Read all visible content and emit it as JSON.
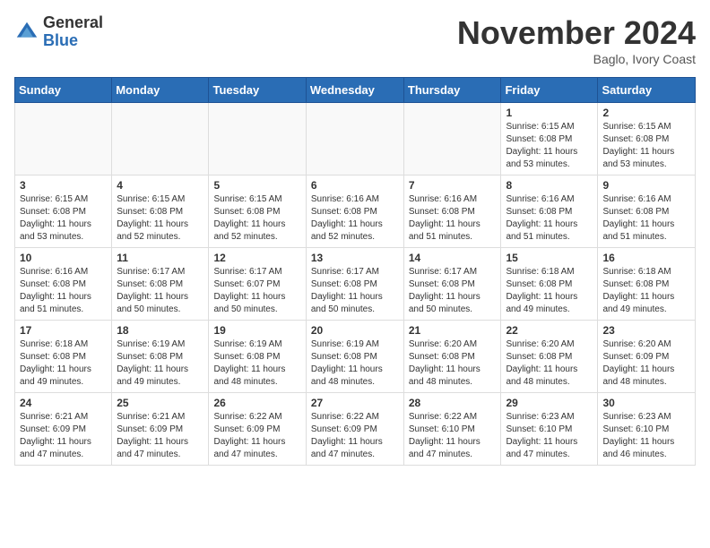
{
  "header": {
    "logo_general": "General",
    "logo_blue": "Blue",
    "month_title": "November 2024",
    "location": "Baglo, Ivory Coast"
  },
  "weekdays": [
    "Sunday",
    "Monday",
    "Tuesday",
    "Wednesday",
    "Thursday",
    "Friday",
    "Saturday"
  ],
  "weeks": [
    [
      {
        "day": "",
        "info": ""
      },
      {
        "day": "",
        "info": ""
      },
      {
        "day": "",
        "info": ""
      },
      {
        "day": "",
        "info": ""
      },
      {
        "day": "",
        "info": ""
      },
      {
        "day": "1",
        "info": "Sunrise: 6:15 AM\nSunset: 6:08 PM\nDaylight: 11 hours\nand 53 minutes."
      },
      {
        "day": "2",
        "info": "Sunrise: 6:15 AM\nSunset: 6:08 PM\nDaylight: 11 hours\nand 53 minutes."
      }
    ],
    [
      {
        "day": "3",
        "info": "Sunrise: 6:15 AM\nSunset: 6:08 PM\nDaylight: 11 hours\nand 53 minutes."
      },
      {
        "day": "4",
        "info": "Sunrise: 6:15 AM\nSunset: 6:08 PM\nDaylight: 11 hours\nand 52 minutes."
      },
      {
        "day": "5",
        "info": "Sunrise: 6:15 AM\nSunset: 6:08 PM\nDaylight: 11 hours\nand 52 minutes."
      },
      {
        "day": "6",
        "info": "Sunrise: 6:16 AM\nSunset: 6:08 PM\nDaylight: 11 hours\nand 52 minutes."
      },
      {
        "day": "7",
        "info": "Sunrise: 6:16 AM\nSunset: 6:08 PM\nDaylight: 11 hours\nand 51 minutes."
      },
      {
        "day": "8",
        "info": "Sunrise: 6:16 AM\nSunset: 6:08 PM\nDaylight: 11 hours\nand 51 minutes."
      },
      {
        "day": "9",
        "info": "Sunrise: 6:16 AM\nSunset: 6:08 PM\nDaylight: 11 hours\nand 51 minutes."
      }
    ],
    [
      {
        "day": "10",
        "info": "Sunrise: 6:16 AM\nSunset: 6:08 PM\nDaylight: 11 hours\nand 51 minutes."
      },
      {
        "day": "11",
        "info": "Sunrise: 6:17 AM\nSunset: 6:08 PM\nDaylight: 11 hours\nand 50 minutes."
      },
      {
        "day": "12",
        "info": "Sunrise: 6:17 AM\nSunset: 6:07 PM\nDaylight: 11 hours\nand 50 minutes."
      },
      {
        "day": "13",
        "info": "Sunrise: 6:17 AM\nSunset: 6:08 PM\nDaylight: 11 hours\nand 50 minutes."
      },
      {
        "day": "14",
        "info": "Sunrise: 6:17 AM\nSunset: 6:08 PM\nDaylight: 11 hours\nand 50 minutes."
      },
      {
        "day": "15",
        "info": "Sunrise: 6:18 AM\nSunset: 6:08 PM\nDaylight: 11 hours\nand 49 minutes."
      },
      {
        "day": "16",
        "info": "Sunrise: 6:18 AM\nSunset: 6:08 PM\nDaylight: 11 hours\nand 49 minutes."
      }
    ],
    [
      {
        "day": "17",
        "info": "Sunrise: 6:18 AM\nSunset: 6:08 PM\nDaylight: 11 hours\nand 49 minutes."
      },
      {
        "day": "18",
        "info": "Sunrise: 6:19 AM\nSunset: 6:08 PM\nDaylight: 11 hours\nand 49 minutes."
      },
      {
        "day": "19",
        "info": "Sunrise: 6:19 AM\nSunset: 6:08 PM\nDaylight: 11 hours\nand 48 minutes."
      },
      {
        "day": "20",
        "info": "Sunrise: 6:19 AM\nSunset: 6:08 PM\nDaylight: 11 hours\nand 48 minutes."
      },
      {
        "day": "21",
        "info": "Sunrise: 6:20 AM\nSunset: 6:08 PM\nDaylight: 11 hours\nand 48 minutes."
      },
      {
        "day": "22",
        "info": "Sunrise: 6:20 AM\nSunset: 6:08 PM\nDaylight: 11 hours\nand 48 minutes."
      },
      {
        "day": "23",
        "info": "Sunrise: 6:20 AM\nSunset: 6:09 PM\nDaylight: 11 hours\nand 48 minutes."
      }
    ],
    [
      {
        "day": "24",
        "info": "Sunrise: 6:21 AM\nSunset: 6:09 PM\nDaylight: 11 hours\nand 47 minutes."
      },
      {
        "day": "25",
        "info": "Sunrise: 6:21 AM\nSunset: 6:09 PM\nDaylight: 11 hours\nand 47 minutes."
      },
      {
        "day": "26",
        "info": "Sunrise: 6:22 AM\nSunset: 6:09 PM\nDaylight: 11 hours\nand 47 minutes."
      },
      {
        "day": "27",
        "info": "Sunrise: 6:22 AM\nSunset: 6:09 PM\nDaylight: 11 hours\nand 47 minutes."
      },
      {
        "day": "28",
        "info": "Sunrise: 6:22 AM\nSunset: 6:10 PM\nDaylight: 11 hours\nand 47 minutes."
      },
      {
        "day": "29",
        "info": "Sunrise: 6:23 AM\nSunset: 6:10 PM\nDaylight: 11 hours\nand 47 minutes."
      },
      {
        "day": "30",
        "info": "Sunrise: 6:23 AM\nSunset: 6:10 PM\nDaylight: 11 hours\nand 46 minutes."
      }
    ]
  ]
}
